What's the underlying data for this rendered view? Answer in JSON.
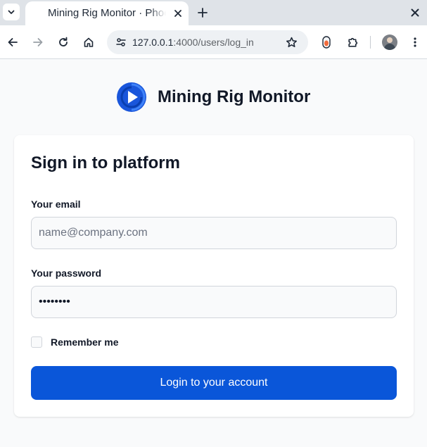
{
  "browser": {
    "tab": {
      "title": "Mining Rig Monitor · Phoenix Framework"
    },
    "address_bar": {
      "host": "127.0.0.1",
      "path": ":4000/users/log_in"
    },
    "icons": {
      "tab_list": "chevron-down-icon",
      "tab_favicon": "globe-icon",
      "tab_close": "close-icon",
      "new_tab": "plus-icon",
      "window_close": "close-icon",
      "back": "arrow-left-icon",
      "forward": "arrow-right-icon",
      "reload": "reload-icon",
      "home": "home-icon",
      "site_info": "tune-icon",
      "bookmark": "star-icon",
      "extension": "flame-icon",
      "extensions": "puzzle-icon",
      "profile": "avatar",
      "menu": "kebab-menu-icon"
    }
  },
  "brand": {
    "name": "Mining Rig Monitor",
    "logo_icon": "play-logo-icon",
    "logo_color": "#1a56db"
  },
  "login": {
    "title": "Sign in to platform",
    "email_label": "Your email",
    "email_placeholder": "name@company.com",
    "email_value": "",
    "password_label": "Your password",
    "password_value": "••••••••",
    "remember_label": "Remember me",
    "remember_checked": false,
    "submit_label": "Login to your account"
  },
  "colors": {
    "page_background": "#f9fafb",
    "card_background": "#ffffff",
    "primary_button": "#0a56d9",
    "input_border": "#d1d5db"
  }
}
